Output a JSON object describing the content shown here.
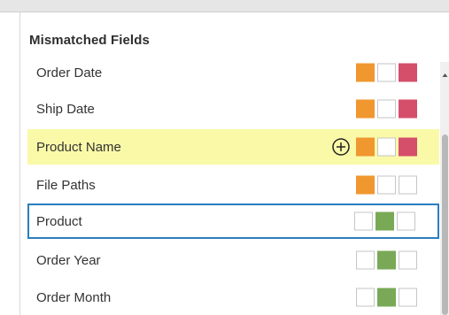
{
  "panel": {
    "title": "Mismatched Fields",
    "colors": {
      "orange": "#f0972f",
      "pink": "#d54f6a",
      "green": "#79a956",
      "highlight": "#faf9a8",
      "selection": "#2a7ebf"
    },
    "items": [
      {
        "label": "Order Date",
        "badges": [
          "orange",
          "empty",
          "pink"
        ],
        "state": "partial-scroll"
      },
      {
        "label": "Ship Date",
        "badges": [
          "orange",
          "empty",
          "pink"
        ],
        "state": "normal"
      },
      {
        "label": "Product Name",
        "badges": [
          "orange",
          "empty",
          "pink"
        ],
        "state": "highlighted",
        "action_icon": "plus-circle-icon"
      },
      {
        "label": "File Paths",
        "badges": [
          "orange",
          "empty",
          "empty"
        ],
        "state": "normal"
      },
      {
        "label": "Product",
        "badges": [
          "empty",
          "green",
          "empty"
        ],
        "state": "selected"
      },
      {
        "label": "Order Year",
        "badges": [
          "empty",
          "green",
          "empty"
        ],
        "state": "normal"
      },
      {
        "label": "Order Month",
        "badges": [
          "empty",
          "green",
          "empty"
        ],
        "state": "normal"
      }
    ]
  }
}
